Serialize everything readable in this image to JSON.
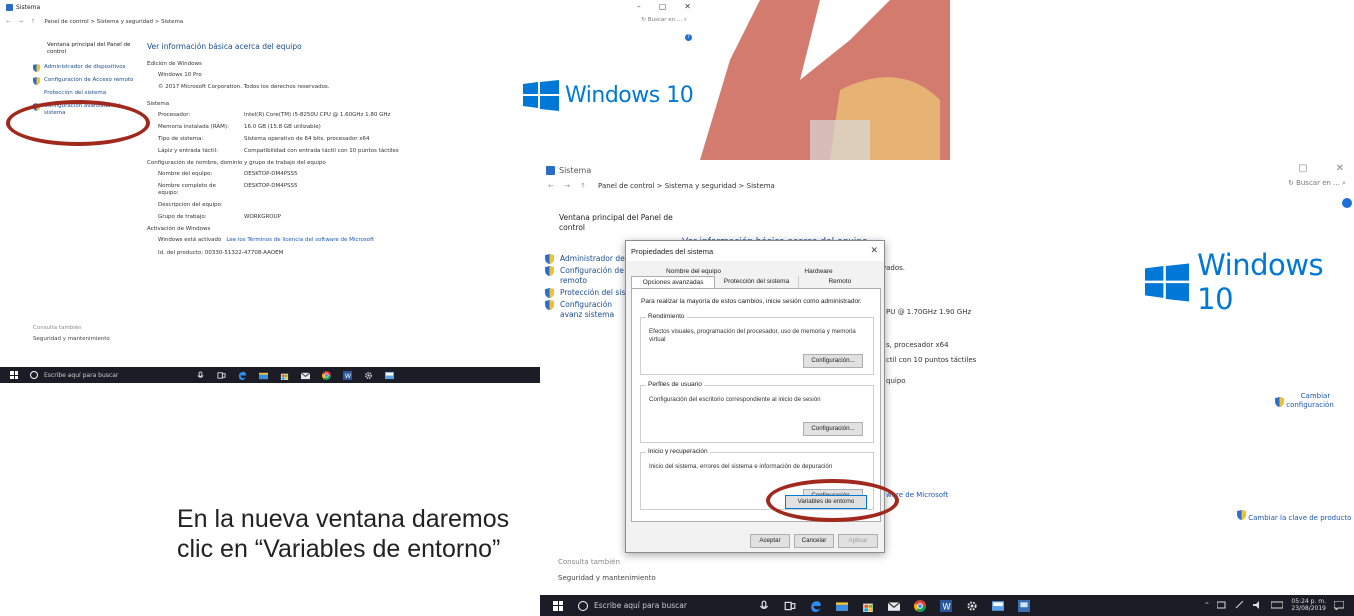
{
  "window1": {
    "title": "Sistema",
    "breadcrumb": "Panel de control  >  Sistema y seguridad  >  Sistema",
    "search_placeholder": "Buscar en ...",
    "sidebar": {
      "home": "Ventana principal del Panel de control",
      "items": [
        "Administrador de dispositivos",
        "Configuración de Acceso remoto",
        "Protección del sistema",
        "Configuración avanzada del sistema"
      ]
    },
    "heading": "Ver información básica acerca del equipo",
    "edition_title": "Edición de Windows",
    "edition_name": "Windows 10 Pro",
    "copyright": "© 2017 Microsoft Corporation. Todos los derechos reservados.",
    "logo_text": "Windows 10",
    "system_title": "Sistema",
    "system_rows": [
      {
        "k": "Procesador:",
        "v": "Intel(R) Core(TM) i5-8250U CPU @ 1.60GHz   1.80 GHz"
      },
      {
        "k": "Memoria instalada (RAM):",
        "v": "16.0 GB (15.8 GB utilizable)"
      },
      {
        "k": "Tipo de sistema:",
        "v": "Sistema operativo de 64 bits, procesador x64"
      },
      {
        "k": "Lápiz y entrada táctil:",
        "v": "Compatibilidad con entrada táctil con 10 puntos táctiles"
      }
    ],
    "name_title": "Configuración de nombre, dominio y grupo de trabajo del equipo",
    "name_rows": [
      {
        "k": "Nombre del equipo:",
        "v": "DESKTOP-DM4PSS5"
      },
      {
        "k": "Nombre completo de equipo:",
        "v": "DESKTOP-DM4PSS5"
      },
      {
        "k": "Descripción del equipo:",
        "v": ""
      },
      {
        "k": "Grupo de trabajo:",
        "v": "WORKGROUP"
      }
    ],
    "activation_title": "Activación de Windows",
    "activation_text": "Windows está activado",
    "license_link": "Lee los Términos de licencia del software de Microsoft",
    "product_id": "Id. del producto: 00330-51322-47708-AAOEM",
    "see_also": "Consulta también",
    "security_link": "Seguridad y mantenimiento",
    "taskbar_search": "Escribe aquí para buscar"
  },
  "window2": {
    "title": "Sistema",
    "breadcrumb": "Panel de control  >  Sistema y seguridad  >  Sistema",
    "search_placeholder": "Buscar en ...",
    "sidebar": {
      "home": "Ventana principal del Panel de control",
      "items": [
        "Administrador de d",
        "Configuración de A remoto",
        "Protección del sister",
        "Configuración avanz sistema"
      ]
    },
    "heading": "Ver información básica acerca del equipo",
    "edition_title": "Edición de Windows",
    "frag_reserved": "vados.",
    "frag_cpu": "PU @ 1.70GHz   1.90 GHz",
    "frag_proc": "s, procesador x64",
    "frag_touch": "ctil con 10 puntos táctiles",
    "frag_equipo": "quipo",
    "frag_ms": "ware de Microsoft",
    "logo_text": "Windows 10",
    "change_config": "Cambiar configuración",
    "change_key": "Cambiar la clave de producto",
    "see_also": "Consulta también",
    "security_link": "Seguridad y mantenimiento",
    "taskbar_search": "Escribe aquí para buscar",
    "clock_time": "05:24 p. m.",
    "clock_date": "23/08/2019"
  },
  "dialog": {
    "title": "Propiedades del sistema",
    "tabs_top": [
      "Nombre del equipo",
      "Hardware"
    ],
    "tabs_bottom": [
      "Opciones avanzadas",
      "Protección del sistema",
      "Remoto"
    ],
    "intro": "Para realizar la mayoría de estos cambios, inicie sesión como administrador.",
    "groups": [
      {
        "title": "Rendimiento",
        "desc": "Efectos visuales, programación del procesador, uso de memoria y memoria virtual",
        "button": "Configuración..."
      },
      {
        "title": "Perfiles de usuario",
        "desc": "Configuración del escritorio correspondiente al inicio de sesión",
        "button": "Configuración..."
      },
      {
        "title": "Inicio y recuperación",
        "desc": "Inicio del sistema, errores del sistema e información de depuración",
        "button": "Configuración..."
      }
    ],
    "env_button": "Variables de entorno",
    "ok": "Aceptar",
    "cancel": "Cancelar",
    "apply": "Aplicar"
  },
  "caption": "En la nueva ventana daremos clic en “Variables de entorno”",
  "colors": {
    "highlight_oval": "#a0281c",
    "win_blue": "#0078d7",
    "link_blue": "#1a57b5",
    "taskbar": "#1c1c26"
  }
}
